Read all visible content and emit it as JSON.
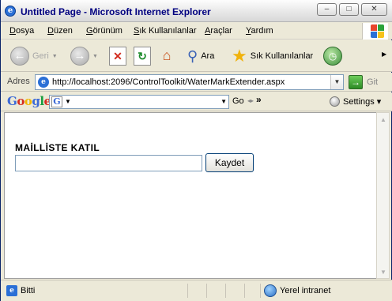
{
  "window": {
    "title": "Untitled Page - Microsoft Internet Explorer",
    "controls": {
      "minimize": "–",
      "maximize": "□",
      "close": "✕"
    }
  },
  "menu": [
    {
      "label": "Dosya",
      "ul": "D",
      "rest": "osya"
    },
    {
      "label": "Düzen",
      "ul": "D",
      "rest": "üzen"
    },
    {
      "label": "Görünüm",
      "ul": "G",
      "rest": "örünüm"
    },
    {
      "label": "Sık Kullanılanlar",
      "ul": "S",
      "rest": "ık Kullanılanlar"
    },
    {
      "label": "Araçlar",
      "ul": "A",
      "rest": "raçlar"
    },
    {
      "label": "Yardım",
      "ul": "Y",
      "rest": "ardım"
    }
  ],
  "toolbar": {
    "back": "Geri",
    "search": "Ara",
    "favorites": "Sık Kullanılanlar"
  },
  "address": {
    "label": "Adres",
    "url": "http://localhost:2096/ControlToolkit/WaterMarkExtender.aspx",
    "go": "Git"
  },
  "google": {
    "logo": [
      "G",
      "o",
      "o",
      "g",
      "l",
      "e"
    ],
    "go": "Go",
    "settings": "Settings"
  },
  "page": {
    "heading": "MAİLLİSTE KATIL",
    "email_value": "",
    "save_button": "Kaydet"
  },
  "status": {
    "text": "Bitti",
    "zone": "Yerel intranet"
  },
  "colors": {
    "title_text": "#000080",
    "chrome": "#ece9d8",
    "input_border": "#7f9db9"
  }
}
